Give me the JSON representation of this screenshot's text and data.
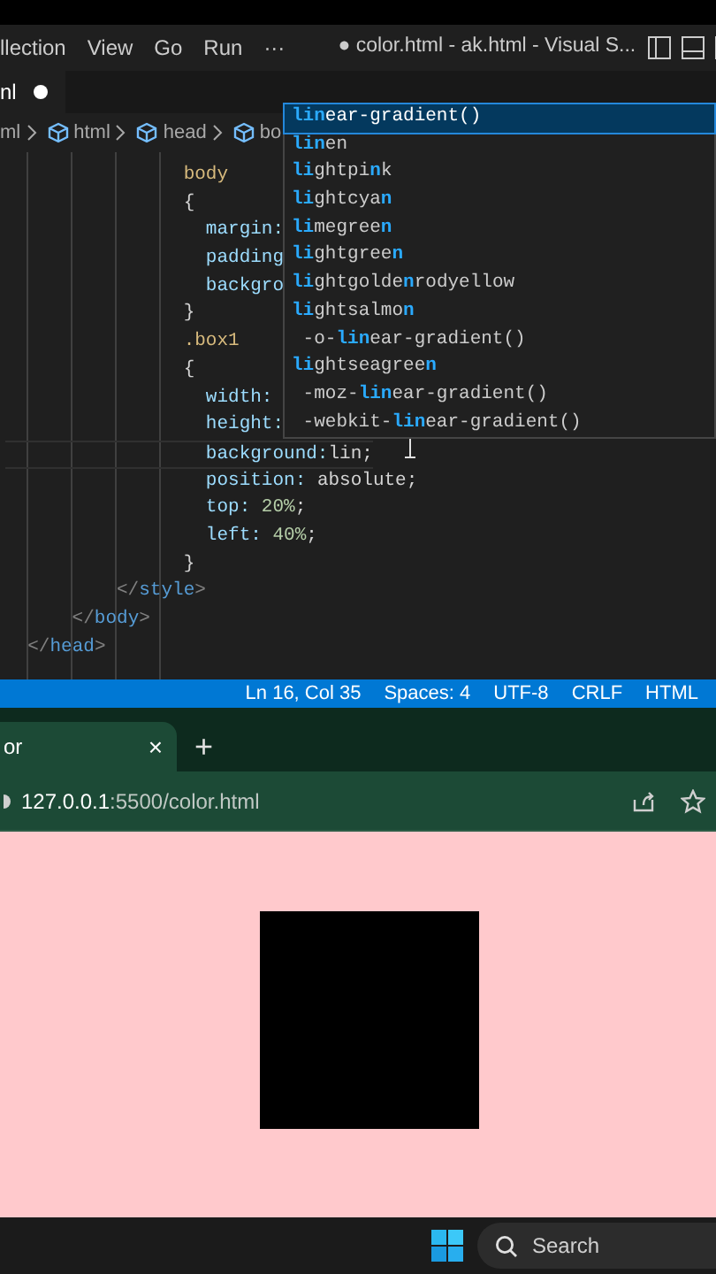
{
  "menu_bar": {
    "items": [
      "llection",
      "View",
      "Go",
      "Run",
      "···"
    ],
    "title": "● color.html - ak.html - Visual S..."
  },
  "editor_tab": {
    "label": "nl",
    "modified": true
  },
  "breadcrumb": [
    {
      "label": "ml",
      "icon": false
    },
    {
      "label": "html",
      "icon": true
    },
    {
      "label": "head",
      "icon": true
    },
    {
      "label": "bo",
      "icon": true
    }
  ],
  "code_lines": [
    {
      "current": false,
      "tokens": [
        {
          "text": "                body",
          "kind": "selector"
        }
      ]
    },
    {
      "current": false,
      "tokens": [
        {
          "text": "                {",
          "kind": "punct"
        }
      ]
    },
    {
      "current": false,
      "tokens": [
        {
          "text": "                  margin:",
          "kind": "property"
        }
      ]
    },
    {
      "current": false,
      "tokens": [
        {
          "text": "                  padding",
          "kind": "property"
        }
      ]
    },
    {
      "current": false,
      "tokens": [
        {
          "text": "                  backgro",
          "kind": "property"
        }
      ]
    },
    {
      "current": false,
      "tokens": [
        {
          "text": "                }",
          "kind": "punct"
        }
      ]
    },
    {
      "current": false,
      "tokens": [
        {
          "text": "                .box1",
          "kind": "selector"
        }
      ]
    },
    {
      "current": false,
      "tokens": [
        {
          "text": "                {",
          "kind": "punct"
        }
      ]
    },
    {
      "current": false,
      "tokens": [
        {
          "text": "                  width:",
          "kind": "property"
        }
      ]
    },
    {
      "current": false,
      "tokens": [
        {
          "text": "                  height:",
          "kind": "property"
        }
      ]
    },
    {
      "current": true,
      "tokens": [
        {
          "text": "                  background:",
          "kind": "property"
        },
        {
          "text": "lin;",
          "kind": "punct"
        }
      ]
    },
    {
      "current": false,
      "tokens": [
        {
          "text": "                  position:",
          "kind": "property"
        },
        {
          "text": " absolute;",
          "kind": "punct"
        }
      ]
    },
    {
      "current": false,
      "tokens": [
        {
          "text": "                  top:",
          "kind": "property"
        },
        {
          "text": " 20%",
          "kind": "number"
        },
        {
          "text": ";",
          "kind": "punct"
        }
      ]
    },
    {
      "current": false,
      "tokens": [
        {
          "text": "                  left:",
          "kind": "property"
        },
        {
          "text": " 40%",
          "kind": "number"
        },
        {
          "text": ";",
          "kind": "punct"
        }
      ]
    },
    {
      "current": false,
      "tokens": [
        {
          "text": "                }",
          "kind": "punct"
        }
      ]
    },
    {
      "current": false,
      "tokens": [
        {
          "text": "          </",
          "kind": "bracket"
        },
        {
          "text": "style",
          "kind": "tag"
        },
        {
          "text": ">",
          "kind": "bracket"
        }
      ]
    },
    {
      "current": false,
      "tokens": [
        {
          "text": "      </",
          "kind": "bracket"
        },
        {
          "text": "body",
          "kind": "tag"
        },
        {
          "text": ">",
          "kind": "bracket"
        }
      ]
    },
    {
      "current": false,
      "tokens": [
        {
          "text": "  </",
          "kind": "bracket"
        },
        {
          "text": "head",
          "kind": "tag"
        },
        {
          "text": ">",
          "kind": "bracket"
        }
      ]
    }
  ],
  "suggestions": [
    {
      "selected": true,
      "segments": [
        {
          "text": "lin",
          "match": true
        },
        {
          "text": "ear-gradient()",
          "match": false
        }
      ]
    },
    {
      "selected": false,
      "segments": [
        {
          "text": "lin",
          "match": true
        },
        {
          "text": "en",
          "match": false
        }
      ]
    },
    {
      "selected": false,
      "segments": [
        {
          "text": "li",
          "match": true
        },
        {
          "text": "ghtpi",
          "match": false
        },
        {
          "text": "n",
          "match": true
        },
        {
          "text": "k",
          "match": false
        }
      ]
    },
    {
      "selected": false,
      "segments": [
        {
          "text": "li",
          "match": true
        },
        {
          "text": "ghtcya",
          "match": false
        },
        {
          "text": "n",
          "match": true
        }
      ]
    },
    {
      "selected": false,
      "segments": [
        {
          "text": "li",
          "match": true
        },
        {
          "text": "megree",
          "match": false
        },
        {
          "text": "n",
          "match": true
        }
      ]
    },
    {
      "selected": false,
      "segments": [
        {
          "text": "li",
          "match": true
        },
        {
          "text": "ghtgree",
          "match": false
        },
        {
          "text": "n",
          "match": true
        }
      ]
    },
    {
      "selected": false,
      "segments": [
        {
          "text": "li",
          "match": true
        },
        {
          "text": "ghtgolde",
          "match": false
        },
        {
          "text": "n",
          "match": true
        },
        {
          "text": "rodyellow",
          "match": false
        }
      ]
    },
    {
      "selected": false,
      "segments": [
        {
          "text": "li",
          "match": true
        },
        {
          "text": "ghtsalmo",
          "match": false
        },
        {
          "text": "n",
          "match": true
        }
      ]
    },
    {
      "selected": false,
      "segments": [
        {
          "text": " -o-",
          "match": false
        },
        {
          "text": "lin",
          "match": true
        },
        {
          "text": "ear-gradient()",
          "match": false
        }
      ]
    },
    {
      "selected": false,
      "segments": [
        {
          "text": "li",
          "match": true
        },
        {
          "text": "ghtseagree",
          "match": false
        },
        {
          "text": "n",
          "match": true
        }
      ]
    },
    {
      "selected": false,
      "segments": [
        {
          "text": " -moz-",
          "match": false
        },
        {
          "text": "lin",
          "match": true
        },
        {
          "text": "ear-gradient()",
          "match": false
        }
      ]
    },
    {
      "selected": false,
      "segments": [
        {
          "text": " -webkit-",
          "match": false
        },
        {
          "text": "lin",
          "match": true
        },
        {
          "text": "ear-gradient()",
          "match": false
        }
      ]
    }
  ],
  "status_bar": [
    "Ln 16, Col 35",
    "Spaces: 4",
    "UTF-8",
    "CRLF",
    "HTML"
  ],
  "browser": {
    "tab": {
      "label": "or",
      "close": "×"
    },
    "new_tab": "+",
    "address": {
      "host": "127.0.0.1",
      "path": ":5500/color.html"
    }
  },
  "taskbar": {
    "search": {
      "placeholder": "Search"
    }
  }
}
